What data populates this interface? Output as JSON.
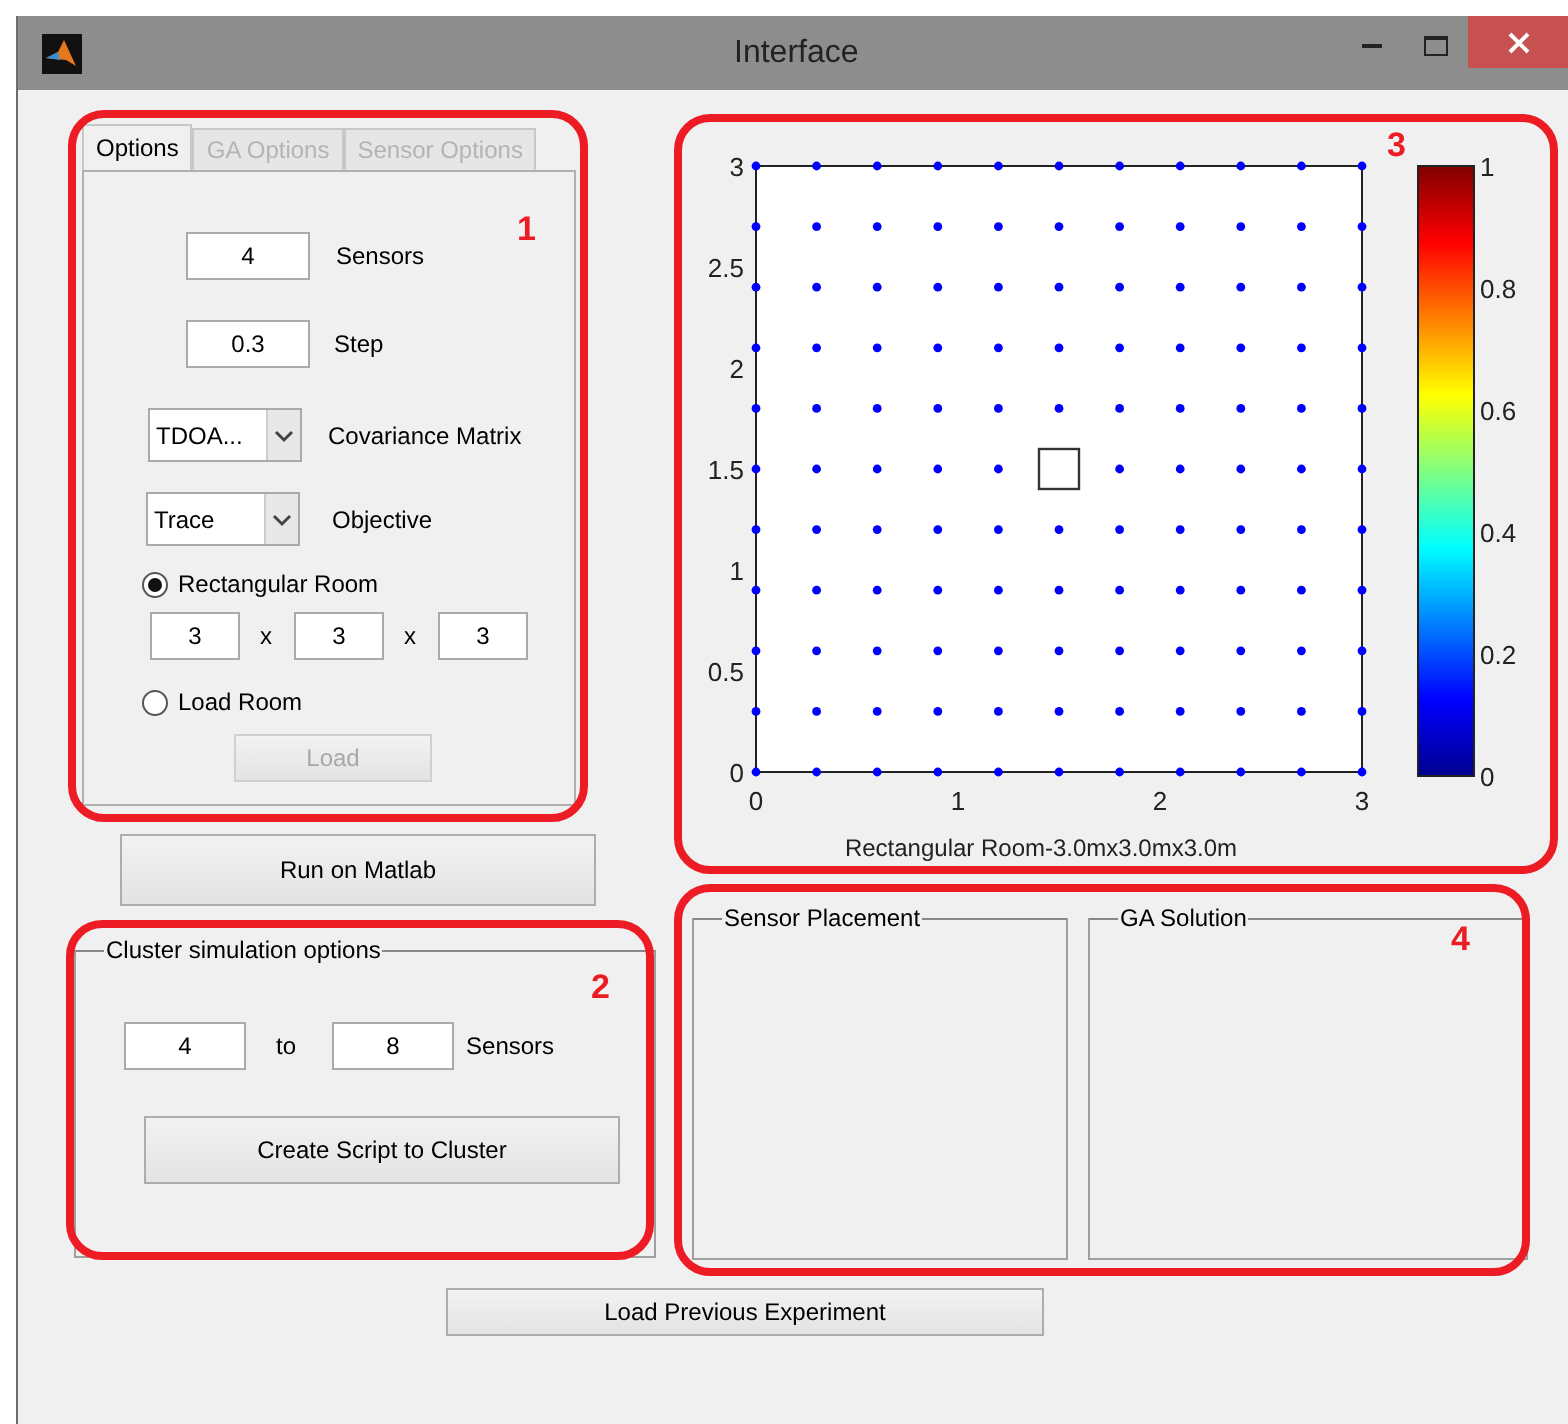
{
  "window": {
    "title": "Interface"
  },
  "options_panel": {
    "annotation": "1",
    "tabs": [
      {
        "label": "Options",
        "selected": true,
        "disabled": false
      },
      {
        "label": "GA Options",
        "selected": false,
        "disabled": true
      },
      {
        "label": "Sensor Options",
        "selected": false,
        "disabled": true
      }
    ],
    "sensors": {
      "value": "4",
      "label": "Sensors"
    },
    "step": {
      "value": "0.3",
      "label": "Step"
    },
    "covariance": {
      "value": "TDOA...",
      "label": "Covariance Matrix"
    },
    "objective": {
      "value": "Trace",
      "label": "Objective"
    },
    "room_options": [
      {
        "label": "Rectangular Room",
        "selected": true
      },
      {
        "label": "Load Room",
        "selected": false
      }
    ],
    "room_size": {
      "values": [
        "3",
        "3",
        "3"
      ],
      "separators": [
        "x",
        "x"
      ]
    },
    "load_button": {
      "label": "Load",
      "disabled": true
    }
  },
  "run_button": "Run on Matlab",
  "cluster": {
    "annotation": "2",
    "title": "Cluster simulation options",
    "from": "4",
    "to_label": "to",
    "to": "8",
    "unit": "Sensors",
    "button": "Create Script to Cluster"
  },
  "plot": {
    "annotation": "3",
    "chart_data": {
      "type": "scatter",
      "xlabel": "Rectangular Room-3.0mx3.0mx3.0m",
      "xlim": [
        0,
        3
      ],
      "ylim": [
        0,
        3
      ],
      "xticks": [
        0,
        1,
        2,
        3
      ],
      "yticks": [
        0,
        0.5,
        1,
        1.5,
        2,
        2.5,
        3
      ],
      "x": [
        0,
        0.3,
        0.6,
        0.9,
        1.2,
        1.5,
        1.8,
        2.1,
        2.4,
        2.7,
        3
      ],
      "series": [
        {
          "color": "#0000ff",
          "values": [
            0,
            0,
            0,
            0,
            0,
            0,
            0,
            0,
            0,
            0,
            0
          ]
        },
        {
          "color": "#0000ff",
          "values": [
            0.3,
            0.3,
            0.3,
            0.3,
            0.3,
            0.3,
            0.3,
            0.3,
            0.3,
            0.3,
            0.3
          ]
        },
        {
          "color": "#0000ff",
          "values": [
            0.6,
            0.6,
            0.6,
            0.6,
            0.6,
            0.6,
            0.6,
            0.6,
            0.6,
            0.6,
            0.6
          ]
        },
        {
          "color": "#0000ff",
          "values": [
            0.9,
            0.9,
            0.9,
            0.9,
            0.9,
            0.9,
            0.9,
            0.9,
            0.9,
            0.9,
            0.9
          ]
        },
        {
          "color": "#0000ff",
          "values": [
            1.2,
            1.2,
            1.2,
            1.2,
            1.2,
            1.2,
            1.2,
            1.2,
            1.2,
            1.2,
            1.2
          ]
        },
        {
          "color": "#0000ff",
          "values": [
            1.5,
            1.5,
            1.5,
            1.5,
            1.5,
            null,
            1.5,
            1.5,
            1.5,
            1.5,
            1.5
          ]
        },
        {
          "color": "#0000ff",
          "values": [
            1.8,
            1.8,
            1.8,
            1.8,
            1.8,
            1.8,
            1.8,
            1.8,
            1.8,
            1.8,
            1.8
          ]
        },
        {
          "color": "#0000ff",
          "values": [
            2.1,
            2.1,
            2.1,
            2.1,
            2.1,
            2.1,
            2.1,
            2.1,
            2.1,
            2.1,
            2.1
          ]
        },
        {
          "color": "#0000ff",
          "values": [
            2.4,
            2.4,
            2.4,
            2.4,
            2.4,
            2.4,
            2.4,
            2.4,
            2.4,
            2.4,
            2.4
          ]
        },
        {
          "color": "#0000ff",
          "values": [
            2.7,
            2.7,
            2.7,
            2.7,
            2.7,
            2.7,
            2.7,
            2.7,
            2.7,
            2.7,
            2.7
          ]
        },
        {
          "color": "#0000ff",
          "values": [
            3,
            3,
            3,
            3,
            3,
            3,
            3,
            3,
            3,
            3,
            3
          ]
        }
      ]
    },
    "markers": [
      {
        "kind": "square"
      }
    ],
    "colorbar": {
      "ticks": [
        "1",
        "0.8",
        "0.6",
        "0.4",
        "0.2",
        "0"
      ]
    }
  },
  "results": {
    "annotation": "4",
    "panels": [
      "Sensor Placement",
      "GA Solution"
    ]
  },
  "load_previous_button": "Load Previous Experiment"
}
